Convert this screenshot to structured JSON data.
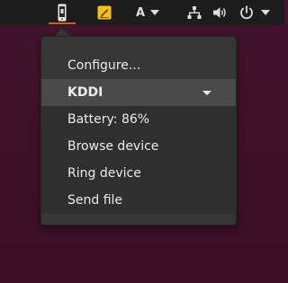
{
  "topbar": {
    "icons": {
      "phone": "smartphone-icon",
      "notes": "sticky-notes-icon",
      "network": "network-wired-icon",
      "volume": "speaker-volume-icon",
      "power": "power-icon",
      "power_menu": "chevron-down-icon",
      "lang_menu": "chevron-down-icon"
    },
    "language_label": "A",
    "accent_color": "#e95420"
  },
  "popup_menu": {
    "configure_label": "Configure...",
    "device_name": "KDDI",
    "battery_text": "Battery: 86%",
    "browse_label": "Browse device",
    "ring_label": "Ring device",
    "send_label": "Send file"
  }
}
